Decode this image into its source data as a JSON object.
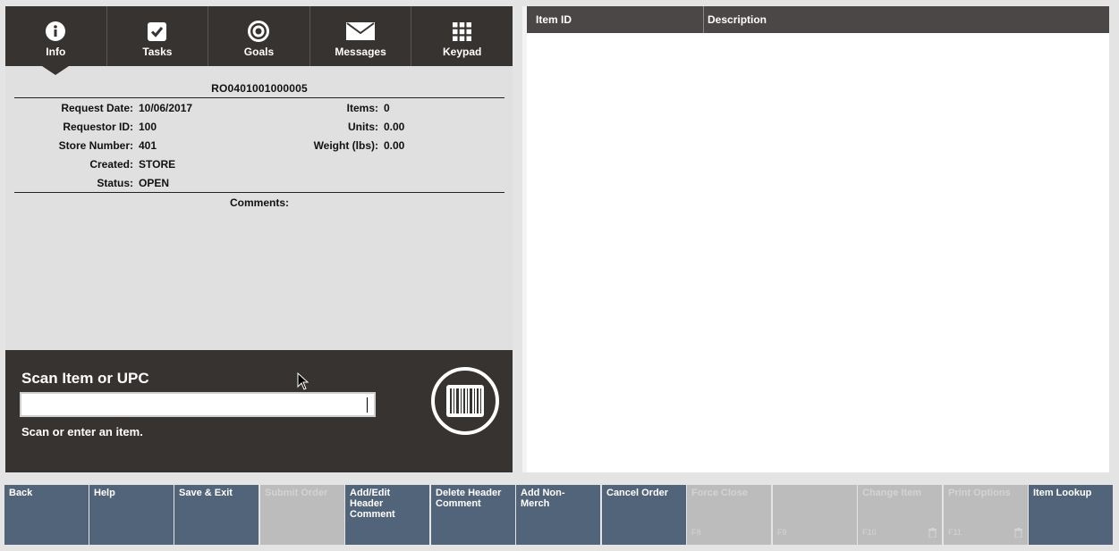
{
  "tabs": [
    {
      "id": "info",
      "label": "Info",
      "icon": "info-icon"
    },
    {
      "id": "tasks",
      "label": "Tasks",
      "icon": "checkbox-icon"
    },
    {
      "id": "goals",
      "label": "Goals",
      "icon": "target-icon"
    },
    {
      "id": "messages",
      "label": "Messages",
      "icon": "envelope-icon"
    },
    {
      "id": "keypad",
      "label": "Keypad",
      "icon": "keypad-icon"
    }
  ],
  "active_tab": "Info",
  "order": {
    "id": "RO0401001000005",
    "request_date_label": "Request Date:",
    "request_date": "10/06/2017",
    "requestor_id_label": "Requestor ID:",
    "requestor_id": "100",
    "store_number_label": "Store Number:",
    "store_number": "401",
    "created_label": "Created:",
    "created": "STORE",
    "status_label": "Status:",
    "status": "OPEN",
    "items_label": "Items:",
    "items": "0",
    "units_label": "Units:",
    "units": "0.00",
    "weight_label": "Weight (lbs):",
    "weight": "0.00",
    "comments_label": "Comments:"
  },
  "scan": {
    "title": "Scan Item or UPC",
    "input_value": "",
    "hint": "Scan or enter an item."
  },
  "item_table": {
    "columns": [
      "Item ID",
      "Description"
    ],
    "rows": []
  },
  "function_buttons": [
    {
      "label": "Back",
      "enabled": true
    },
    {
      "label": "Help",
      "enabled": true
    },
    {
      "label": "Save & Exit",
      "enabled": true
    },
    {
      "label": "Submit Order",
      "enabled": false
    },
    {
      "label": "Add/Edit Header Comment",
      "enabled": true
    },
    {
      "label": "Delete Header Comment",
      "enabled": true
    },
    {
      "label": "Add Non-Merch",
      "enabled": true
    },
    {
      "label": "Cancel Order",
      "enabled": true
    },
    {
      "label": "Force Close",
      "key": "F8",
      "enabled": false
    },
    {
      "label": "",
      "key": "F9",
      "enabled": false
    },
    {
      "label": "Change Item",
      "key": "F10",
      "enabled": false,
      "trash": true
    },
    {
      "label": "Print Options",
      "key": "F11",
      "enabled": false,
      "trash": true
    },
    {
      "label": "Item Lookup",
      "enabled": true
    }
  ],
  "colors": {
    "dark_panel": "#373330",
    "button_enabled": "#52647a",
    "button_disabled": "#bcbcbc",
    "table_header": "#4b4746"
  }
}
